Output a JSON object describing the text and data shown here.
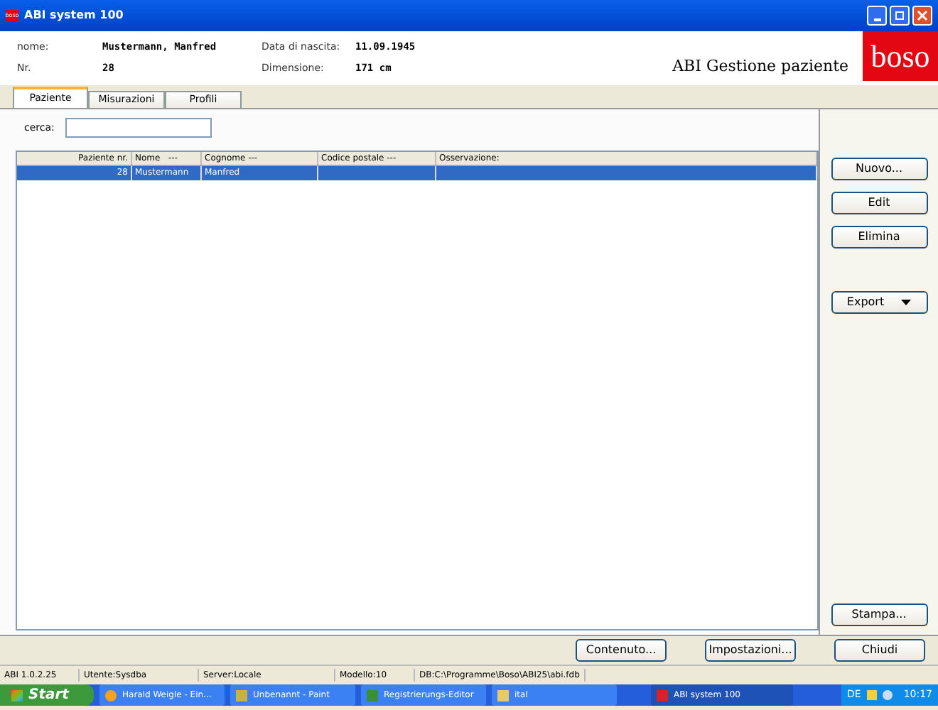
{
  "window": {
    "title": "ABI system 100",
    "logo": "boso"
  },
  "header": {
    "fields": [
      {
        "label": "nome:",
        "value": "Mustermann, Manfred"
      },
      {
        "label": "Nr.",
        "value": "28"
      },
      {
        "label": "Data di nascita:",
        "value": "11.09.1945"
      },
      {
        "label": "Dimensione:",
        "value": "171 cm"
      }
    ],
    "app_name": "ABI Gestione paziente",
    "brand": "boso"
  },
  "tabs": [
    {
      "label": "Paziente",
      "selected": true
    },
    {
      "label": "Misurazioni",
      "selected": false
    },
    {
      "label": "Profili",
      "selected": false
    }
  ],
  "search": {
    "label": "cerca:"
  },
  "table": {
    "columns": [
      "Paziente nr.",
      "Nome   ---",
      "Cognome ---",
      "Codice postale ---",
      "Osservazione:"
    ],
    "rows": [
      {
        "cells": [
          "28",
          "Mustermann",
          "Manfred",
          "",
          ""
        ],
        "selected": true
      }
    ]
  },
  "side_buttons": [
    {
      "label": "Nuovo..."
    },
    {
      "label": "Edit"
    },
    {
      "label": "Elimina"
    },
    {
      "label": "Export",
      "kind": "dropdown"
    },
    {
      "label": "Stampa..."
    }
  ],
  "bottom_buttons": [
    "Contenuto...",
    "Impostazioni...",
    "Chiudi"
  ],
  "status_bar": [
    "ABI 1.0.2.25",
    "Utente:Sysdba",
    "Server:Locale",
    "Modello:10",
    "DB:C:\\Programme\\Boso\\ABI25\\abi.fdb"
  ],
  "taskbar": {
    "start": "Start",
    "tasks": [
      {
        "label": "Harald Weigle - Ein...",
        "selected": false
      },
      {
        "label": "Unbenannt - Paint",
        "selected": false
      },
      {
        "label": "Registrierungs-Editor",
        "selected": false
      },
      {
        "label": "ital",
        "selected": false
      },
      {
        "label": "ABI system 100",
        "selected": true
      }
    ],
    "language": "DE",
    "time": "10:17"
  }
}
